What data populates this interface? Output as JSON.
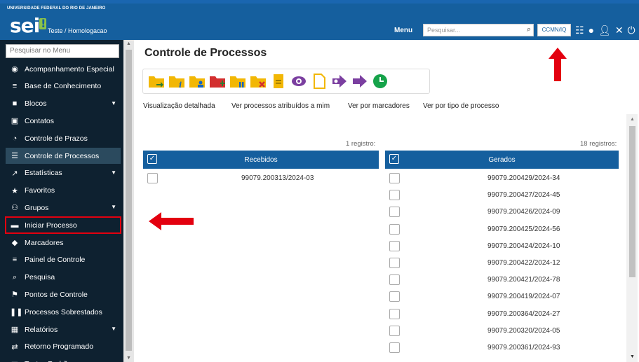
{
  "header": {
    "institution": "UNIVERSIDADE FEDERAL DO RIO DE JANEIRO",
    "logo": "sei",
    "environment": "Teste / Homologacao",
    "menu_label": "Menu",
    "search_placeholder": "Pesquisar...",
    "unit": "CCMN/IQ",
    "icons": [
      "grid-icon",
      "globe-icon",
      "user-icon",
      "tools-icon",
      "power-icon"
    ]
  },
  "sidebar": {
    "search_placeholder": "Pesquisar no Menu",
    "items": [
      {
        "label": "Acompanhamento Especial",
        "icon": "eye-icon"
      },
      {
        "label": "Base de Conhecimento",
        "icon": "database-icon"
      },
      {
        "label": "Blocos",
        "icon": "briefcase-icon",
        "caret": true
      },
      {
        "label": "Contatos",
        "icon": "contact-card-icon"
      },
      {
        "label": "Controle de Prazos",
        "icon": "clock-icon"
      },
      {
        "label": "Controle de Processos",
        "icon": "list-icon",
        "active": true
      },
      {
        "label": "Estatísticas",
        "icon": "chart-icon",
        "caret": true
      },
      {
        "label": "Favoritos",
        "icon": "star-icon"
      },
      {
        "label": "Grupos",
        "icon": "group-icon",
        "caret": true
      },
      {
        "label": "Iniciar Processo",
        "icon": "folder-icon",
        "highlight": true
      },
      {
        "label": "Marcadores",
        "icon": "tag-icon"
      },
      {
        "label": "Painel de Controle",
        "icon": "menu-icon"
      },
      {
        "label": "Pesquisa",
        "icon": "search-icon"
      },
      {
        "label": "Pontos de Controle",
        "icon": "flag-icon"
      },
      {
        "label": "Processos Sobrestados",
        "icon": "pause-icon"
      },
      {
        "label": "Relatórios",
        "icon": "table-icon",
        "caret": true
      },
      {
        "label": "Retorno Programado",
        "icon": "exchange-icon"
      },
      {
        "label": "Textos Padrão",
        "icon": "document-icon"
      }
    ]
  },
  "main": {
    "title": "Controle de Processos",
    "toolbar_icons": [
      "folder-send-icon",
      "folder-info-icon",
      "folder-user-icon",
      "folder-add-icon",
      "folder-pause-icon",
      "folder-close-icon",
      "note-icon",
      "eye-icon",
      "new-document-icon",
      "forward-icon",
      "send-icon",
      "clock-icon"
    ],
    "view_links": [
      "Visualização detalhada",
      "Ver processos atribuídos a mim",
      "Ver por marcadores",
      "Ver por tipo de processo"
    ],
    "received": {
      "count": "1 registro:",
      "header": "Recebidos",
      "rows": [
        "99079.200313/2024-03"
      ]
    },
    "generated": {
      "count": "18 registros:",
      "header": "Gerados",
      "rows": [
        "99079.200429/2024-34",
        "99079.200427/2024-45",
        "99079.200426/2024-09",
        "99079.200425/2024-56",
        "99079.200424/2024-10",
        "99079.200422/2024-12",
        "99079.200421/2024-78",
        "99079.200419/2024-07",
        "99079.200364/2024-27",
        "99079.200320/2024-05",
        "99079.200361/2024-93"
      ]
    }
  },
  "colors": {
    "header": "#155f9e",
    "sidebar": "#0e2130",
    "highlight": "#e3000f",
    "toolbar_icons": "#f2b705"
  }
}
